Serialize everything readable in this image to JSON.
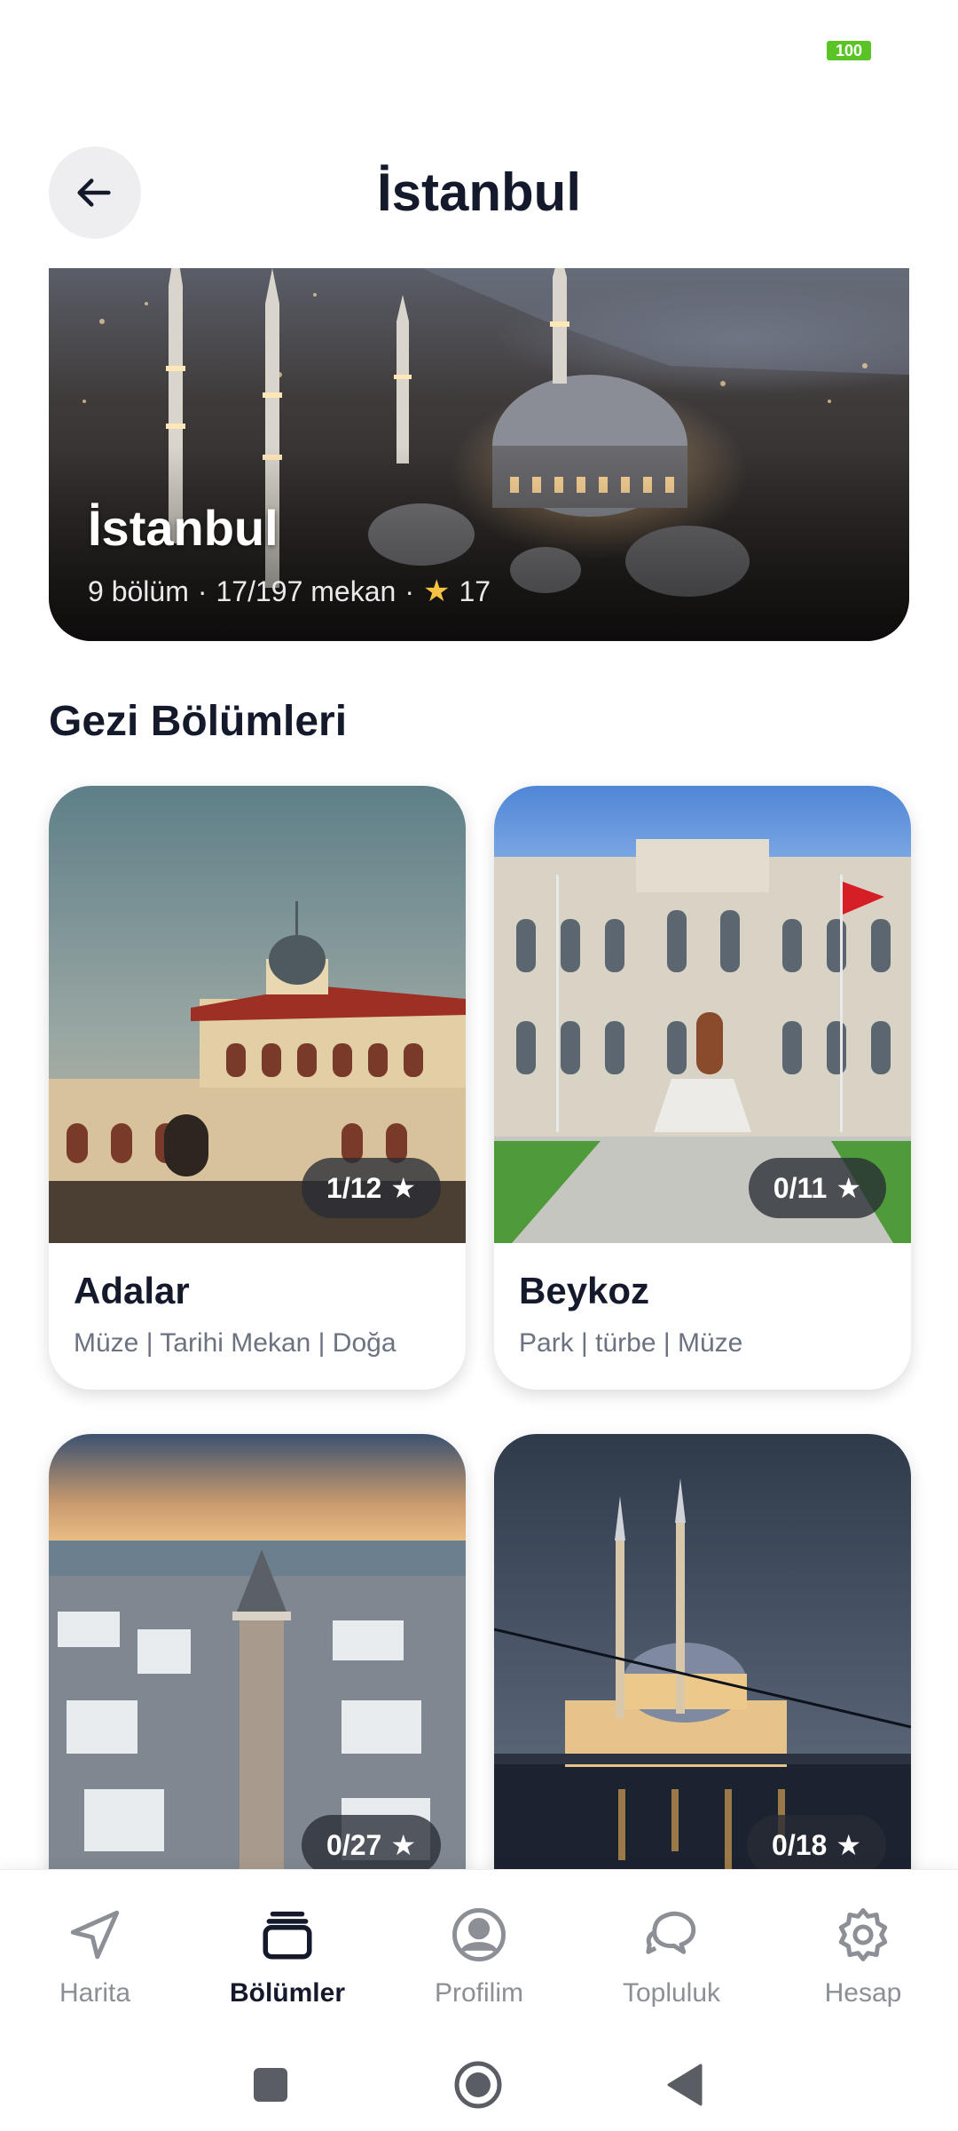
{
  "status_bar": {
    "battery_level": "100"
  },
  "header": {
    "title": "İstanbul",
    "back_label": ""
  },
  "hero": {
    "title": "İstanbul",
    "sections": "9 bölüm",
    "places": "17/197 mekan",
    "stars": "17",
    "separator": "·"
  },
  "section": {
    "title": "Gezi Bölümleri"
  },
  "cards": [
    {
      "title": "Adalar",
      "tags": "Müze | Tarihi Mekan | Doğa",
      "progress": "1/12"
    },
    {
      "title": "Beykoz",
      "tags": "Park | türbe | Müze",
      "progress": "0/11"
    },
    {
      "title": "",
      "tags": "",
      "progress": "0/27"
    },
    {
      "title": "",
      "tags": "",
      "progress": "0/18"
    }
  ],
  "nav": {
    "items": [
      {
        "label": "Harita",
        "icon": "navigation-arrow-icon"
      },
      {
        "label": "Bölümler",
        "icon": "cards-stack-icon",
        "active": true
      },
      {
        "label": "Profilim",
        "icon": "user-circle-icon"
      },
      {
        "label": "Topluluk",
        "icon": "chat-bubbles-icon"
      },
      {
        "label": "Hesap",
        "icon": "gear-icon"
      }
    ]
  },
  "colors": {
    "text_primary": "#141a2b",
    "text_muted": "#6b7280",
    "nav_inactive": "#8c8f95",
    "battery": "#5ac426",
    "star": "#f5c242"
  }
}
